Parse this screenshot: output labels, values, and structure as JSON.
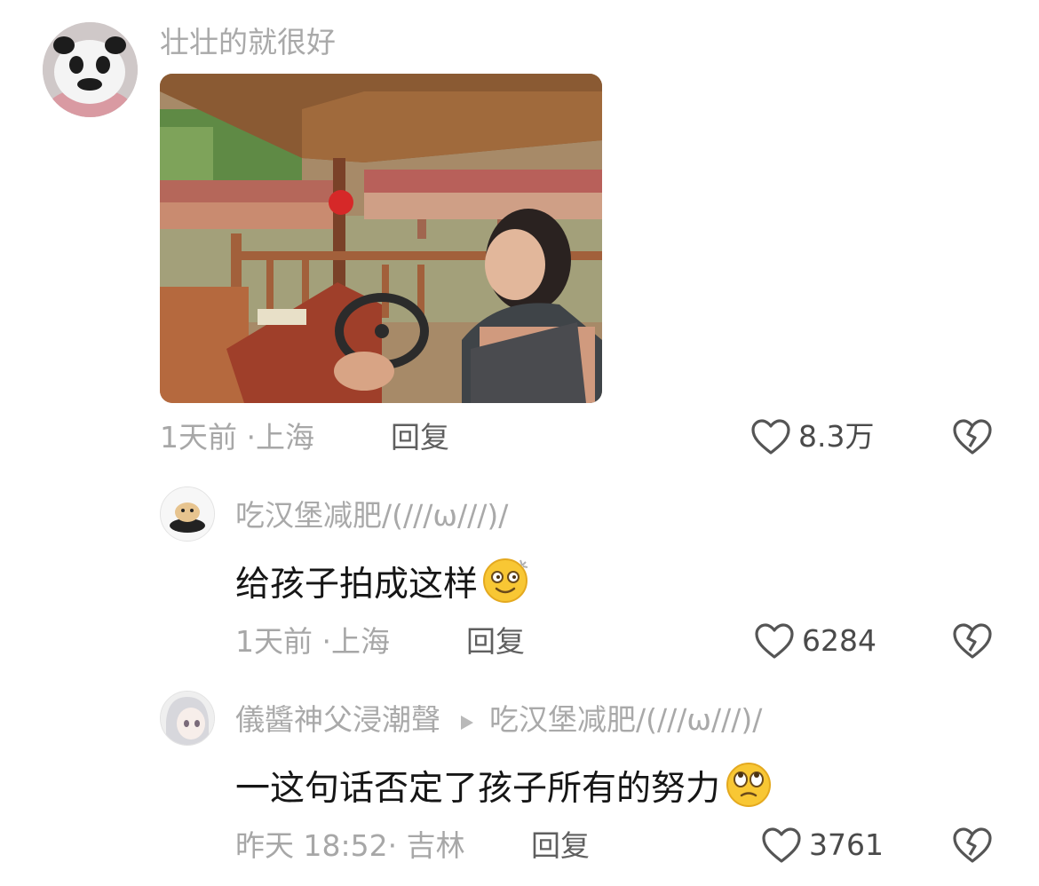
{
  "comments": [
    {
      "username": "壮壮的就很好",
      "has_image": true,
      "time": "1天前",
      "location": "上海",
      "reply_label": "回复",
      "likes": "8.3万",
      "avatar_icon": "panda-avatar"
    },
    {
      "username": "吃汉堡减肥/(///ω///)/",
      "text": "给孩子拍成这样",
      "emoji": "dizzy-face-emoji",
      "time": "1天前",
      "location": "上海",
      "reply_label": "回复",
      "likes": "6284",
      "avatar_icon": "hamburger-avatar"
    },
    {
      "username": "儀醬神父浸潮聲",
      "reply_to": "吃汉堡减肥/(///ω///)/",
      "text": "一这句话否定了孩子所有的努力",
      "emoji": "eye-roll-emoji",
      "time": "昨天 18:52",
      "location": "吉林",
      "reply_label": "回复",
      "likes": "3761",
      "avatar_icon": "anime-avatar"
    }
  ],
  "separator": "·",
  "colors": {
    "username": "#a9a9a9",
    "text": "#161616",
    "meta": "#a7a7a7"
  }
}
